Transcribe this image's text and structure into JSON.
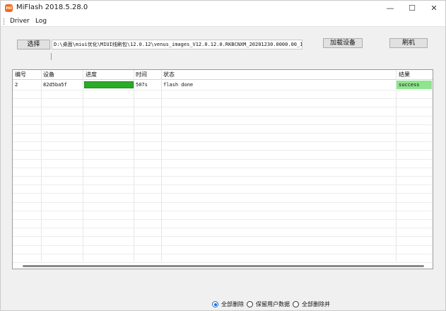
{
  "window": {
    "title": "MiFlash 2018.5.28.0",
    "icon_text": "mi",
    "minimize": "—",
    "maximize": "☐",
    "close": "✕"
  },
  "menu": {
    "items": [
      "Driver",
      "Log"
    ]
  },
  "toolbar": {
    "select_label": "选择",
    "path_value": "D:\\桌面\\miui优化\\MIUI线刷包\\12.0.12\\venus_images_V12.0.12.0.RKBCNXM_20201230.0000.00_11.",
    "load_device_label": "加载设备",
    "flash_label": "刷机"
  },
  "table": {
    "columns": [
      "编号",
      "设备",
      "进度",
      "时间",
      "状态",
      "结果"
    ],
    "rows": [
      {
        "id": "2",
        "device": "82d5ba5f",
        "progress": 1.0,
        "time": "507s",
        "status": "flash done",
        "result": "success"
      }
    ],
    "progress_color": "#2aaa2a",
    "success_color": "#8ee58e"
  },
  "status": {
    "options": [
      "全部删除",
      "保留用户数据",
      "全部删除并"
    ],
    "selected_index": 0
  }
}
